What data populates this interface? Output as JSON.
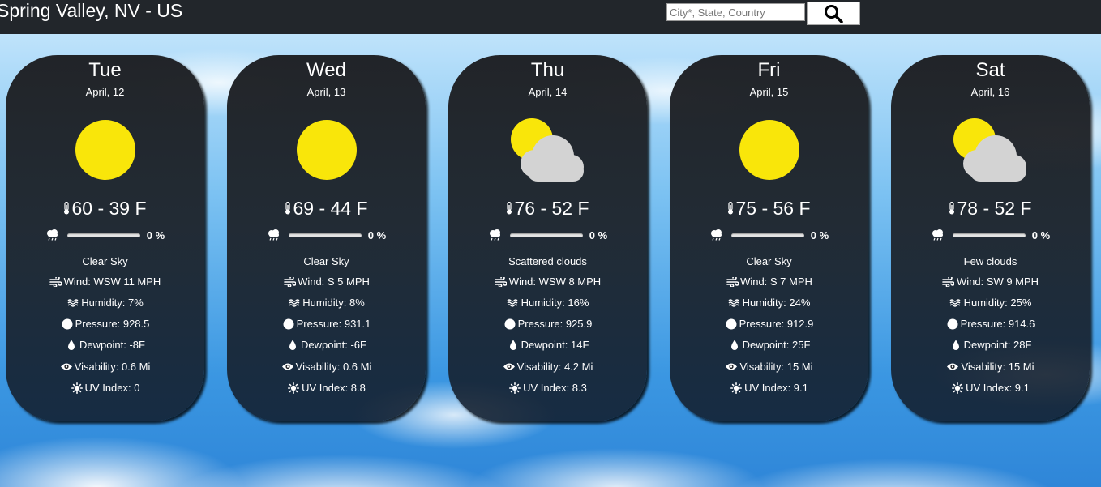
{
  "header": {
    "location": "Spring Valley, NV - US",
    "search_placeholder": "City*, State, Country",
    "search_icon": "magnifier-icon"
  },
  "colors": {
    "topbar": "#22262b",
    "card": "#1e2024",
    "sun": "#f9e60a",
    "cloud": "#d3d3d3"
  },
  "days": [
    {
      "day": "Tue",
      "date": "April, 12",
      "icon": "sun",
      "temp": "60 - 39 F",
      "precip": "0 %",
      "desc": "Clear Sky",
      "wind": "Wind: WSW 11 MPH",
      "humidity": "Humidity: 7%",
      "pressure": "Pressure: 928.5",
      "dewpoint": "Dewpoint: -8F",
      "visibility": "Visability: 0.6 Mi",
      "uv": "UV Index: 0"
    },
    {
      "day": "Wed",
      "date": "April, 13",
      "icon": "sun",
      "temp": "69 - 44 F",
      "precip": "0 %",
      "desc": "Clear Sky",
      "wind": "Wind: S 5 MPH",
      "humidity": "Humidity: 8%",
      "pressure": "Pressure: 931.1",
      "dewpoint": "Dewpoint: -6F",
      "visibility": "Visability: 0.6 Mi",
      "uv": "UV Index: 8.8"
    },
    {
      "day": "Thu",
      "date": "April, 14",
      "icon": "sun-cloud",
      "temp": "76 - 52 F",
      "precip": "0 %",
      "desc": "Scattered clouds",
      "wind": "Wind: WSW 8 MPH",
      "humidity": "Humidity: 16%",
      "pressure": "Pressure: 925.9",
      "dewpoint": "Dewpoint: 14F",
      "visibility": "Visability: 4.2 Mi",
      "uv": "UV Index: 8.3"
    },
    {
      "day": "Fri",
      "date": "April, 15",
      "icon": "sun",
      "temp": "75 - 56 F",
      "precip": "0 %",
      "desc": "Clear Sky",
      "wind": "Wind: S 7 MPH",
      "humidity": "Humidity: 24%",
      "pressure": "Pressure: 912.9",
      "dewpoint": "Dewpoint: 25F",
      "visibility": "Visability: 15 Mi",
      "uv": "UV Index: 9.1"
    },
    {
      "day": "Sat",
      "date": "April, 16",
      "icon": "sun-cloud",
      "temp": "78 - 52 F",
      "precip": "0 %",
      "desc": "Few clouds",
      "wind": "Wind: SW 9 MPH",
      "humidity": "Humidity: 25%",
      "pressure": "Pressure: 914.6",
      "dewpoint": "Dewpoint: 28F",
      "visibility": "Visability: 15 Mi",
      "uv": "UV Index: 9.1"
    }
  ]
}
